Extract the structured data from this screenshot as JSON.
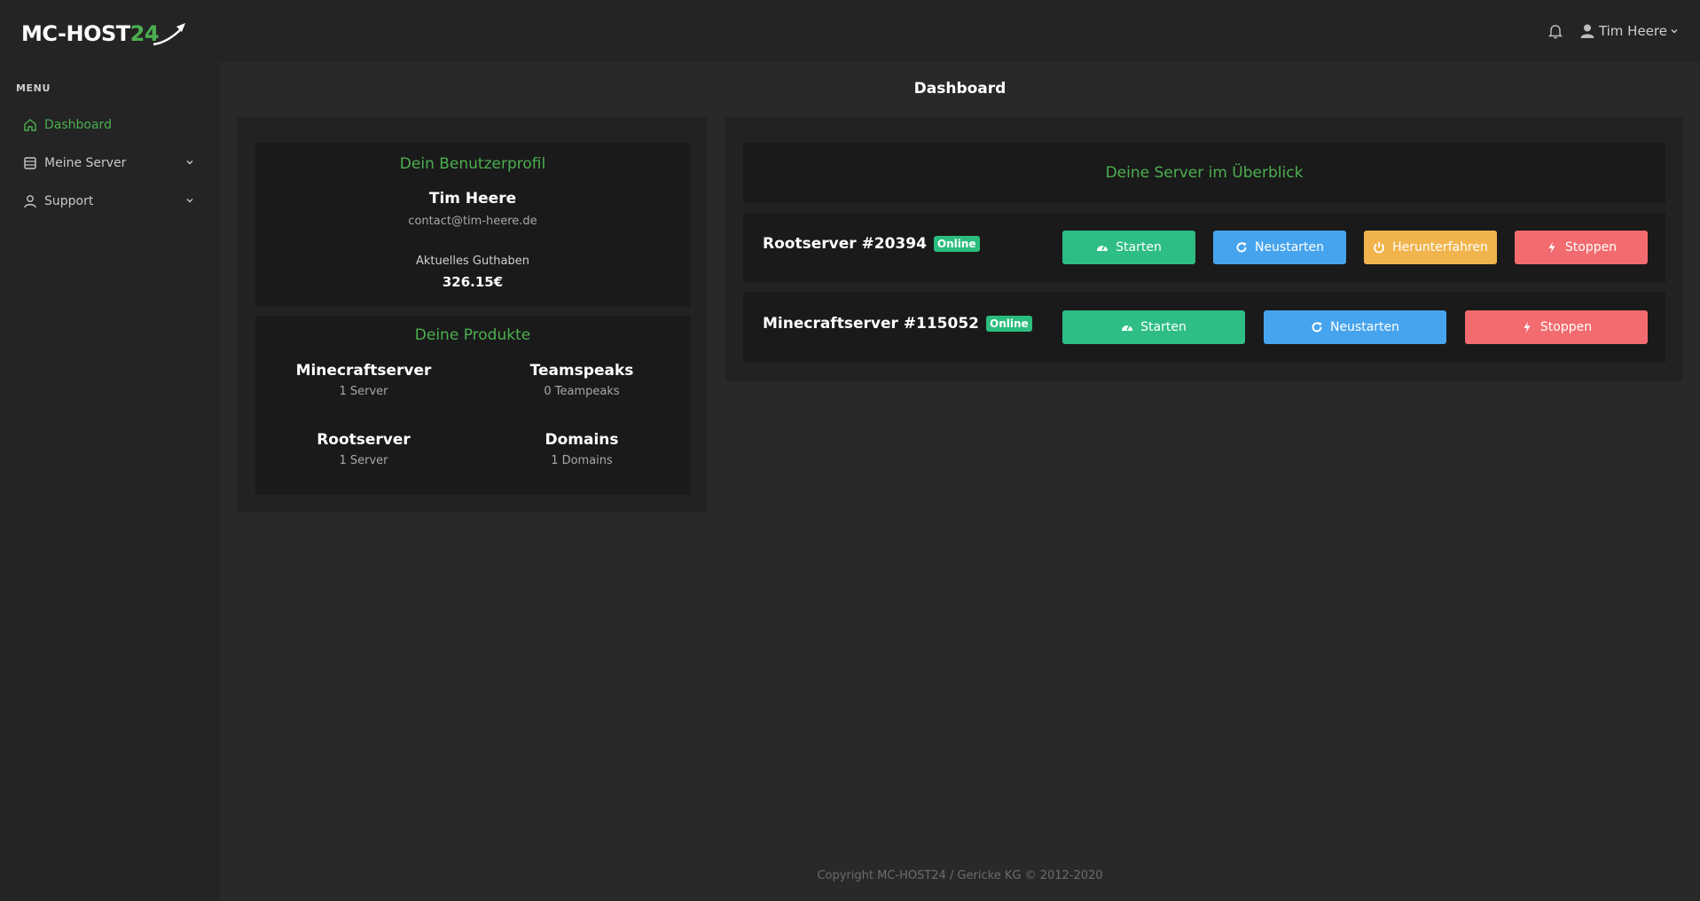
{
  "brand": {
    "logo_main": "MC-HOST",
    "logo_accent": "24"
  },
  "header": {
    "user_name": "Tim Heere"
  },
  "sidebar": {
    "menu_title": "MENU",
    "items": [
      {
        "label": "Dashboard",
        "icon": "home-icon",
        "active": true
      },
      {
        "label": "Meine Server",
        "icon": "server-icon",
        "has_submenu": true
      },
      {
        "label": "Support",
        "icon": "user-icon",
        "has_submenu": true
      }
    ]
  },
  "page": {
    "title": "Dashboard"
  },
  "profile": {
    "title": "Dein Benutzerprofil",
    "name": "Tim Heere",
    "email": "contact@tim-heere.de",
    "balance_label": "Aktuelles Guthaben",
    "balance": "326.15€"
  },
  "products": {
    "title": "Deine Produkte",
    "items": [
      {
        "name": "Minecraftserver",
        "count": "1 Server"
      },
      {
        "name": "Teamspeaks",
        "count": "0 Teampeaks"
      },
      {
        "name": "Rootserver",
        "count": "1 Server"
      },
      {
        "name": "Domains",
        "count": "1 Domains"
      }
    ]
  },
  "servers": {
    "title": "Deine Server im Überblick",
    "list": [
      {
        "name": "Rootserver #20394",
        "status": "Online",
        "buttons": {
          "start": "Starten",
          "restart": "Neustarten",
          "shutdown": "Herunterfahren",
          "stop": "Stoppen"
        }
      },
      {
        "name": "Minecraftserver #115052",
        "status": "Online",
        "buttons": {
          "start": "Starten",
          "restart": "Neustarten",
          "stop": "Stoppen"
        }
      }
    ]
  },
  "colors": {
    "accent": "#4caf50",
    "success": "#2ebd85",
    "info": "#46a4ee",
    "warning": "#f1b44c",
    "danger": "#f26b6e"
  },
  "footer": {
    "text": "Copyright MC-HOST24 / Gericke KG © 2012-2020"
  }
}
